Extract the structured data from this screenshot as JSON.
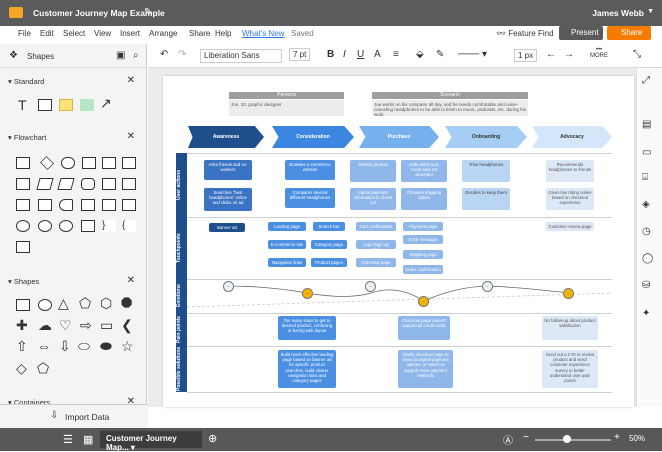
{
  "app": {
    "doc_title": "Customer Journey Map Example",
    "user": "James Webb"
  },
  "menu": {
    "items": [
      "File",
      "Edit",
      "Select",
      "View",
      "Insert",
      "Arrange",
      "Share",
      "Help"
    ],
    "whats_new": "What's New",
    "saved": "Saved",
    "feature_find": "Feature Find",
    "present": "Present",
    "share": "Share"
  },
  "left": {
    "title": "Shapes",
    "sections": {
      "standard": "Standard",
      "flowchart": "Flowchart",
      "shapes": "Shapes",
      "containers": "Containers"
    },
    "import": "Import Data"
  },
  "toolbar": {
    "font": "Liberation Sans",
    "size": "7 pt",
    "line_size": "1 px",
    "more": "MORE"
  },
  "bottom": {
    "tab": "Customer Journey Map...",
    "zoom": "50%"
  },
  "diagram": {
    "persona": {
      "label": "Persona",
      "text": "Joe, 32, graphic designer"
    },
    "scenario": {
      "label": "Scenario",
      "text": "Joe works on his computer all day, and he needs comfortable and noise-canceling headphones to be able to listen to music, podcasts, etc. during his work."
    },
    "stages": [
      "Awareness",
      "Consideration",
      "Purchase",
      "Onboarding",
      "Advocacy"
    ],
    "lanes": [
      "User actions",
      "Touchpoints",
      "Emotions",
      "Pain points",
      "Possible solutions"
    ],
    "cards": {
      "a1": "Asks friends and co-workers",
      "a2": "Searches \"best headphones\" online and clicks on ad",
      "c1": "Browses e-commerce website",
      "c2": "Compares several different headphones",
      "p1": "Selects product",
      "p2": "Inputs payment information to check out",
      "p3": "Adds debit card, credit card not accepted",
      "p4": "Chooses shipping option",
      "o1": "Tries headphones",
      "o2": "Decides to keep them",
      "v1": "Recommends headphones to friends",
      "v2": "Gives low rating online based on checkout experience",
      "t1": "Banner ad",
      "t2": "Landing page",
      "t3": "Search bar",
      "t4": "E-commerce site",
      "t5": "Category page",
      "t6": "Navigation links",
      "t7": "Product pages",
      "t8": "Cart confirmation",
      "t9": "Login/sign-up page",
      "t10": "Checkout page",
      "t11": "Payment page",
      "t12": "Error message",
      "t13": "Shipping page",
      "t14": "Order confirmation",
      "t15": "Customer review page",
      "pp1": "Too many steps to get to desired product, confusing or boring web layout",
      "pp2": "Checkout page doesn't support all credit cards",
      "pp3": "No follow-up about product satisfaction",
      "s1": "Build more effective landing page based on banner ad for specific product searches, build clearer navigation links and category pages",
      "s2": "Clarify checkout page to show accepted payment options, or switch to support more payment methods",
      "s3": "Send out a CTA to review product and send customer experience survey to better understand user pain points"
    }
  }
}
